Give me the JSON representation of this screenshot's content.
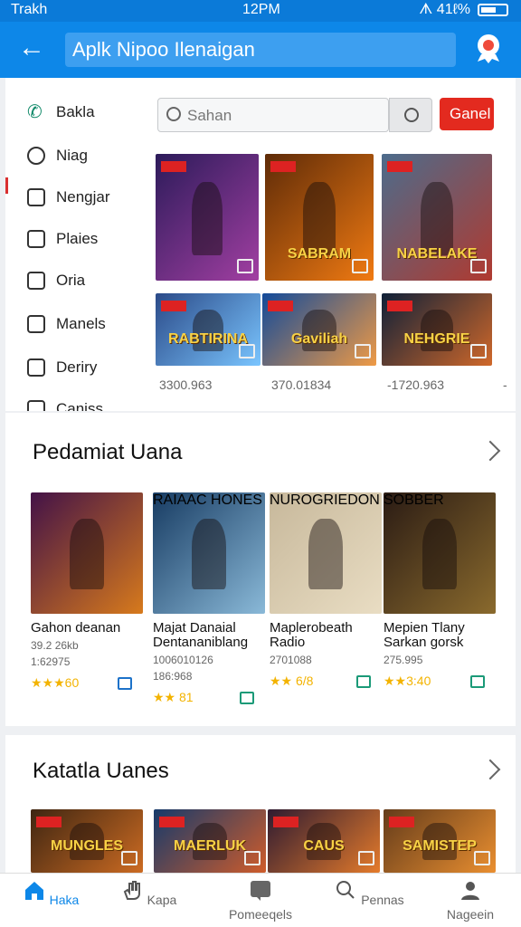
{
  "status": {
    "left": "Trakh",
    "time": "12PM",
    "right": "ᗑ 41ℓ%"
  },
  "appbar": {
    "title": "Aplk Nipoo Ilenaigan"
  },
  "sidebar": {
    "items": [
      {
        "label": "Bakla"
      },
      {
        "label": "Niag"
      },
      {
        "label": "Nengjar"
      },
      {
        "label": "Plaies"
      },
      {
        "label": "Oria"
      },
      {
        "label": "Manels"
      },
      {
        "label": "Deriry"
      },
      {
        "label": "Caniss"
      }
    ]
  },
  "search": {
    "placeholder": "Sahan",
    "cancel": "Ganel"
  },
  "featured": {
    "tiles": [
      {
        "label": "",
        "color1": "#2c1b5a",
        "color2": "#a23fa2"
      },
      {
        "label": "SABRAM",
        "color1": "#5e2b08",
        "color2": "#f07a12"
      },
      {
        "label": "NABELAKE",
        "color1": "#4c6c8c",
        "color2": "#b03a30"
      },
      {
        "label": "RABTIRINA",
        "color1": "#2b4a88",
        "color2": "#7ac5ff"
      },
      {
        "label": "Gaviliah",
        "color1": "#124a9a",
        "color2": "#ef9a45"
      },
      {
        "label": "NEHGRIE",
        "color1": "#0f2038",
        "color2": "#d0682a"
      }
    ],
    "counts": [
      "3300.963",
      "370.01834",
      "-1720.963",
      "-"
    ]
  },
  "section1": {
    "title": "Pedamiat Uana",
    "games": [
      {
        "name": "Gahon deanan",
        "meta1": "39.2 26kb",
        "meta2": "1:62975",
        "rating": "★★★60",
        "art_label": "",
        "c1": "#431247",
        "c2": "#d77a1c"
      },
      {
        "name": "Majat Danaial",
        "name2": "Dentananiblang",
        "meta1": "1006010126",
        "meta2": "186:968",
        "rating": "★★ 81",
        "art_label": "RAIAAC HONES",
        "c1": "#173b62",
        "c2": "#8ab9d8"
      },
      {
        "name": "Maplerobeath",
        "name2": "Radio",
        "meta1": "2701088",
        "meta2": "",
        "rating": "★★ 6/8",
        "art_label": "NUROGRIEDON",
        "c1": "#c7b89b",
        "c2": "#e9ddc3"
      },
      {
        "name": "Mepien Tlany",
        "name2": "Sarkan gorsk",
        "meta1": "275.995",
        "meta2": "",
        "rating": "★★3:40",
        "art_label": "SOBBER",
        "c1": "#2a1b14",
        "c2": "#8a6a2d"
      }
    ]
  },
  "section2": {
    "title": "Katatla Uanes",
    "tiles": [
      {
        "label": "MUNGLES",
        "c1": "#3f2612",
        "c2": "#cc6b22"
      },
      {
        "label": "MAERLUK",
        "c1": "#163a6b",
        "c2": "#cf5c2b"
      },
      {
        "label": "CAUS",
        "c1": "#2f1b31",
        "c2": "#e57b2b"
      },
      {
        "label": "SAMISTEP",
        "c1": "#643c1b",
        "c2": "#ea8f30"
      }
    ]
  },
  "bottomnav": [
    {
      "label": "Haka",
      "icon": "home-icon",
      "active": true
    },
    {
      "label": "Kapa",
      "icon": "hand-icon"
    },
    {
      "label": "Pomeeqels",
      "icon": "message-icon"
    },
    {
      "label": "Pennas",
      "icon": "search-icon"
    },
    {
      "label": "Nageein",
      "icon": "profile-icon"
    }
  ]
}
